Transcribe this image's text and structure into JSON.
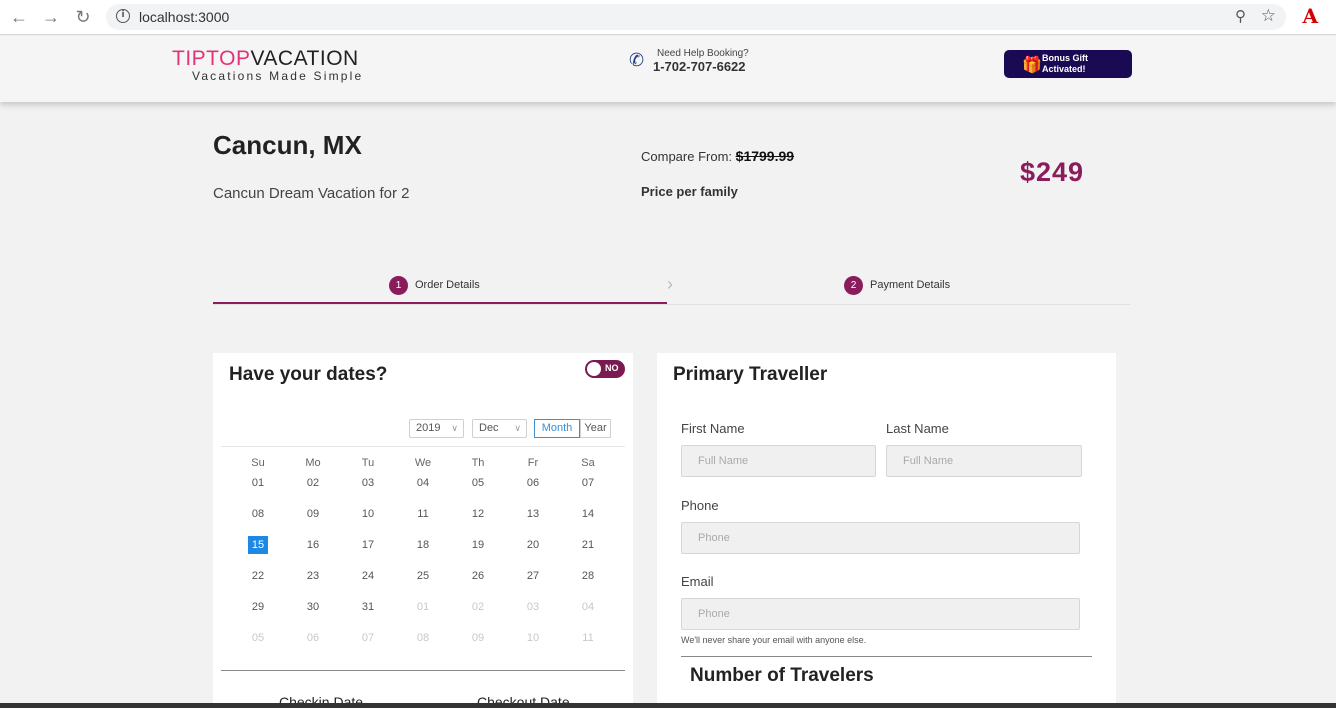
{
  "browser": {
    "url": "localhost:3000",
    "back_icon": "back-arrow-icon",
    "forward_icon": "forward-arrow-icon",
    "reload_icon": "reload-icon"
  },
  "header": {
    "logo_tip": "TIPTOP",
    "logo_vacation": "VACATION",
    "tagline": "Vacations Made Simple",
    "help_label": "Need Help Booking?",
    "help_phone": "1-702-707-6622",
    "bonus_line1": "Bonus Gift",
    "bonus_line2": "Activated!"
  },
  "trip": {
    "destination": "Cancun, MX",
    "package": "Cancun Dream Vacation for 2",
    "compare_label": "Compare From:",
    "compare_price": "$1799.99",
    "price_note": "Price per family",
    "price": "$249"
  },
  "steps": [
    {
      "num": "1",
      "label": "Order Details"
    },
    {
      "num": "2",
      "label": "Payment Details"
    }
  ],
  "dates": {
    "title": "Have your dates?",
    "toggle_label": "NO",
    "year": "2019",
    "month": "Dec",
    "mode_month": "Month",
    "mode_year": "Year",
    "weekdays": [
      "Su",
      "Mo",
      "Tu",
      "We",
      "Th",
      "Fr",
      "Sa"
    ],
    "weeks": [
      [
        "01",
        "02",
        "03",
        "04",
        "05",
        "06",
        "07"
      ],
      [
        "08",
        "09",
        "10",
        "11",
        "12",
        "13",
        "14"
      ],
      [
        "15",
        "16",
        "17",
        "18",
        "19",
        "20",
        "21"
      ],
      [
        "22",
        "23",
        "24",
        "25",
        "26",
        "27",
        "28"
      ],
      [
        "29",
        "30",
        "31",
        "01",
        "02",
        "03",
        "04"
      ],
      [
        "05",
        "06",
        "07",
        "08",
        "09",
        "10",
        "11"
      ]
    ],
    "selected_day": "15",
    "checkin_label": "Checkin Date",
    "checkout_label": "Checkout Date"
  },
  "traveller": {
    "title": "Primary Traveller",
    "first_name_label": "First Name",
    "first_name_placeholder": "Full Name",
    "last_name_label": "Last Name",
    "last_name_placeholder": "Full Name",
    "phone_label": "Phone",
    "phone_placeholder": "Phone",
    "email_label": "Email",
    "email_placeholder": "Phone",
    "email_hint": "We'll never share your email with anyone else.",
    "travelers_title": "Number of Travelers"
  }
}
